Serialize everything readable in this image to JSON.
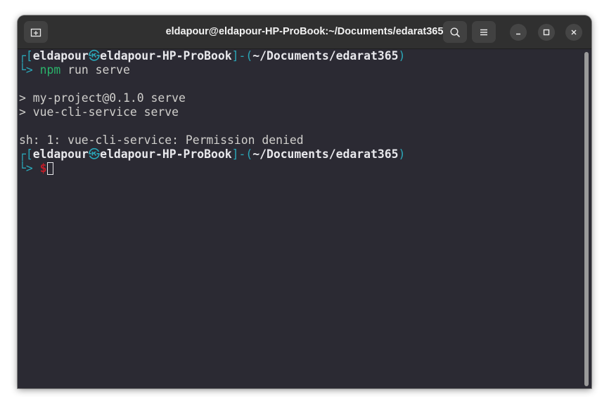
{
  "window": {
    "title": "eldapour@eldapour-HP-ProBook:~/Documents/edarat365"
  },
  "toolbar": {
    "new_tab_icon": "new-tab-icon",
    "search_icon": "search-icon",
    "menu_icon": "hamburger-menu-icon",
    "minimize_icon": "minimize-icon",
    "maximize_icon": "maximize-icon",
    "close_icon": "close-icon"
  },
  "terminal": {
    "prompt1": {
      "corner_top": "┌",
      "open_bracket": "[",
      "user": "eldapour",
      "at": "㉿",
      "host": "eldapour-HP-ProBook",
      "close_bracket": "]",
      "dash": "-",
      "open_paren": "(",
      "path": "~/Documents/edarat365",
      "close_paren": ")",
      "corner_bottom": "└",
      "arrow": ">",
      "cmd_npm": "npm",
      "cmd_args": " run serve"
    },
    "output": [
      "> my-project@0.1.0 serve",
      "> vue-cli-service serve",
      "sh: 1: vue-cli-service: Permission denied"
    ],
    "prompt2": {
      "corner_top": "┌",
      "open_bracket": "[",
      "user": "eldapour",
      "at": "㉿",
      "host": "eldapour-HP-ProBook",
      "close_bracket": "]",
      "dash": "-",
      "open_paren": "(",
      "path": "~/Documents/edarat365",
      "close_paren": ")",
      "corner_bottom": "└",
      "arrow": ">",
      "dollar": "$"
    }
  },
  "colors": {
    "window_bg": "#2b2a33",
    "titlebar_bg": "#303030",
    "prompt_cyan": "#2aa7b8",
    "command_green": "#2bb36b",
    "dollar_red": "#c01c28",
    "text": "#d0cfcc"
  }
}
